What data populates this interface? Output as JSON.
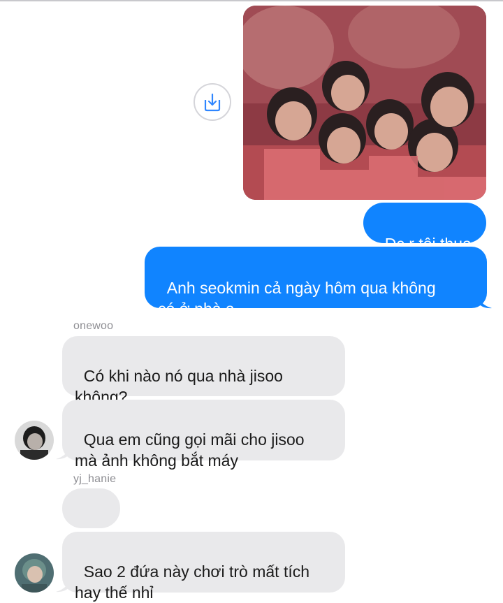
{
  "thread": {
    "messages": [
      {
        "from": "me",
        "kind": "image",
        "alt": "photo-collage"
      },
      {
        "from": "me",
        "text": "Đc r tôi thua"
      },
      {
        "from": "me",
        "text": "Anh seokmin cả ngày hôm qua không\ncó ở nhà ạ"
      },
      {
        "from": "onewoo",
        "text": "Có khi nào nó qua nhà jisoo\nkhông?"
      },
      {
        "from": "onewoo",
        "text": "Qua em cũng gọi mãi cho jisoo\nmà ảnh không bắt máy"
      },
      {
        "from": "yj_hanie",
        "text": "????"
      },
      {
        "from": "yj_hanie",
        "text": "Sao 2 đứa này chơi trò mất tích\nhay thế nhỉ"
      }
    ],
    "senders": {
      "onewoo": "onewoo",
      "yj_hanie": "yj_hanie"
    }
  },
  "icons": {
    "save": "download-tray-icon"
  },
  "colors": {
    "sent_bubble": "#1084ff",
    "received_bubble": "#e9e9eb",
    "sender_name": "#8e8e93",
    "save_icon": "#2f86ff"
  }
}
